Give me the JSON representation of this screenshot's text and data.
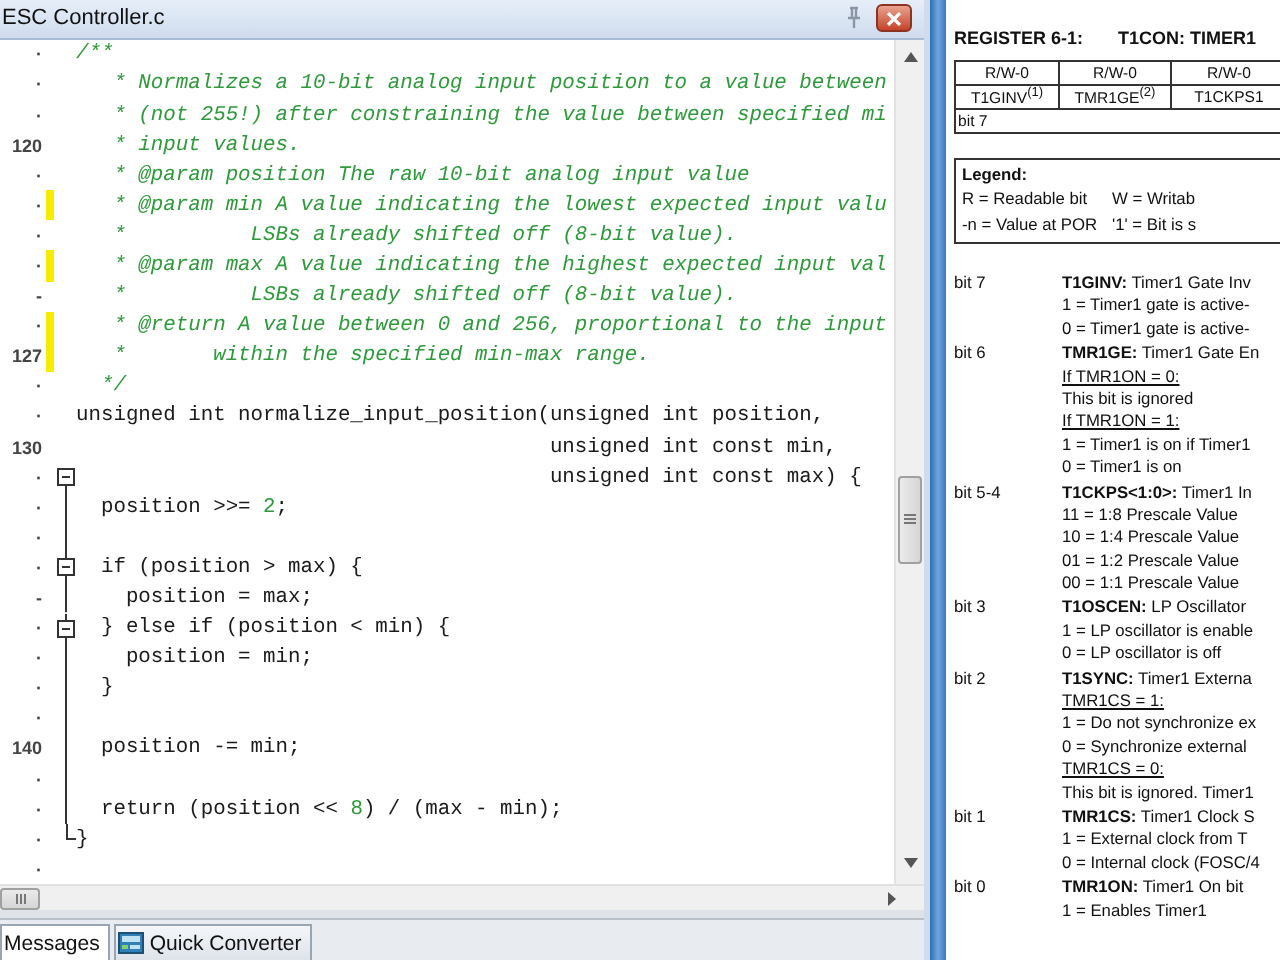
{
  "editor": {
    "title": "ESC Controller.c",
    "lines": [
      {
        "gutter": "·",
        "changed": false,
        "parts": [
          {
            "text": "/**",
            "kind": "comment"
          }
        ]
      },
      {
        "gutter": "·",
        "changed": false,
        "parts": [
          {
            "text": "   * Normalizes a 10-bit analog input position to a value between",
            "kind": "comment"
          }
        ]
      },
      {
        "gutter": "·",
        "changed": false,
        "parts": [
          {
            "text": "   * (not 255!) after constraining the value between specified mi",
            "kind": "comment"
          }
        ]
      },
      {
        "gutter": "120",
        "changed": false,
        "parts": [
          {
            "text": "   * input values.",
            "kind": "comment"
          }
        ]
      },
      {
        "gutter": "·",
        "changed": false,
        "parts": [
          {
            "text": "   * @param position The raw 10-bit analog input value",
            "kind": "comment"
          }
        ]
      },
      {
        "gutter": "·",
        "changed": true,
        "parts": [
          {
            "text": "   * @param min A value indicating the lowest expected input valu",
            "kind": "comment"
          }
        ]
      },
      {
        "gutter": "·",
        "changed": false,
        "parts": [
          {
            "text": "   *          LSBs already shifted off (8-bit value).",
            "kind": "comment"
          }
        ]
      },
      {
        "gutter": "·",
        "changed": true,
        "parts": [
          {
            "text": "   * @param max A value indicating the highest expected input val",
            "kind": "comment"
          }
        ]
      },
      {
        "gutter": "-",
        "changed": false,
        "parts": [
          {
            "text": "   *          LSBs already shifted off (8-bit value).",
            "kind": "comment"
          }
        ]
      },
      {
        "gutter": "·",
        "changed": true,
        "parts": [
          {
            "text": "   * @return A value between 0 and 256, proportional to the input",
            "kind": "comment"
          }
        ]
      },
      {
        "gutter": "127",
        "changed": true,
        "parts": [
          {
            "text": "   *       within the specified min-max range.",
            "kind": "comment"
          }
        ]
      },
      {
        "gutter": "·",
        "changed": false,
        "parts": [
          {
            "text": "  */",
            "kind": "comment"
          }
        ]
      },
      {
        "gutter": "·",
        "changed": false,
        "parts": [
          {
            "text": "unsigned int normalize_input_position(unsigned int position,",
            "kind": "code"
          }
        ]
      },
      {
        "gutter": "130",
        "changed": false,
        "parts": [
          {
            "text": "                                      unsigned int const min,",
            "kind": "code"
          }
        ]
      },
      {
        "gutter": "·",
        "changed": false,
        "kind": "fold_start",
        "parts": [
          {
            "text": "                                      unsigned int const max) {",
            "kind": "code"
          }
        ]
      },
      {
        "gutter": "·",
        "changed": false,
        "kind": "fold_body",
        "parts": [
          {
            "text": "  position >>= ",
            "kind": "code"
          },
          {
            "text": "2",
            "kind": "number"
          },
          {
            "text": ";",
            "kind": "code"
          }
        ]
      },
      {
        "gutter": "·",
        "changed": false,
        "kind": "fold_body"
      },
      {
        "gutter": "·",
        "changed": false,
        "kind": "fold_nested",
        "parts": [
          {
            "text": "  if (position > max) {",
            "kind": "code"
          }
        ]
      },
      {
        "gutter": "-",
        "changed": false,
        "kind": "fold_body",
        "parts": [
          {
            "text": "    position = max;",
            "kind": "code"
          }
        ]
      },
      {
        "gutter": "·",
        "changed": false,
        "kind": "fold_nested",
        "parts": [
          {
            "text": "  } else if (position < min) {",
            "kind": "code"
          }
        ]
      },
      {
        "gutter": "·",
        "changed": false,
        "kind": "fold_body",
        "parts": [
          {
            "text": "    position = min;",
            "kind": "code"
          }
        ]
      },
      {
        "gutter": "·",
        "changed": false,
        "kind": "fold_body",
        "parts": [
          {
            "text": "  }",
            "kind": "code"
          }
        ]
      },
      {
        "gutter": "·",
        "changed": false,
        "kind": "fold_body"
      },
      {
        "gutter": "140",
        "changed": false,
        "kind": "fold_body",
        "parts": [
          {
            "text": "  position -= min;",
            "kind": "code"
          }
        ]
      },
      {
        "gutter": "·",
        "changed": false,
        "kind": "fold_body"
      },
      {
        "gutter": "·",
        "changed": false,
        "kind": "fold_body",
        "parts": [
          {
            "text": "  return (position << ",
            "kind": "code"
          },
          {
            "text": "8",
            "kind": "number"
          },
          {
            "text": ") / (max - min);",
            "kind": "code"
          }
        ]
      },
      {
        "gutter": "·",
        "changed": false,
        "kind": "fold_end",
        "parts": [
          {
            "text": "}",
            "kind": "code"
          }
        ]
      },
      {
        "gutter": "·",
        "changed": false
      }
    ]
  },
  "bottom_tabs": [
    {
      "label": "Messages",
      "selected": true
    },
    {
      "label": "Quick Converter",
      "selected": false
    }
  ],
  "datasheet": {
    "register_label": "REGISTER 6-1:",
    "register_name": "T1CON: TIMER1",
    "table": {
      "access": [
        "R/W-0",
        "R/W-0",
        "R/W-0"
      ],
      "bits": [
        "T1GINV$^{(1)}$",
        "TMR1GE$^{(2)}$",
        "T1CKPS1"
      ],
      "bit_label": "bit 7"
    },
    "legend": {
      "title": "Legend:",
      "entries": [
        "R = Readable bit",
        "W = Writab",
        "-n = Value at POR",
        "'1' = Bit is s"
      ]
    },
    "bits": [
      {
        "label": "bit 7",
        "title": "**T1GINV:** Timer1 Gate Inv",
        "lines": [
          {
            "text": "1 = Timer1 gate is active-",
            "kind": "value"
          },
          {
            "text": "0 = Timer1 gate is active-",
            "kind": "value"
          }
        ]
      },
      {
        "label": "bit 6",
        "title": "**TMR1GE:** Timer1 Gate En",
        "lines": [
          {
            "text": "If TMR1ON = 0:",
            "kind": "condition"
          },
          {
            "text": "This bit is ignored",
            "kind": "value"
          },
          {
            "text": "If TMR1ON = 1:",
            "kind": "condition"
          },
          {
            "text": "1 = Timer1 is on if Timer1",
            "kind": "value"
          },
          {
            "text": "0 = Timer1 is on",
            "kind": "value"
          }
        ]
      },
      {
        "label": "bit 5-4",
        "title": "**T1CKPS<1:0>:** Timer1 In",
        "lines": [
          {
            "text": "11 = 1:8 Prescale Value",
            "kind": "value"
          },
          {
            "text": "10 = 1:4 Prescale Value",
            "kind": "value"
          },
          {
            "text": "01 = 1:2 Prescale Value",
            "kind": "value"
          },
          {
            "text": "00 = 1:1 Prescale Value",
            "kind": "value"
          }
        ]
      },
      {
        "label": "bit 3",
        "title": "**T1OSCEN:** LP Oscillator",
        "lines": [
          {
            "text": "1 = LP oscillator is enable",
            "kind": "value"
          },
          {
            "text": "0 = LP oscillator is off",
            "kind": "value"
          }
        ]
      },
      {
        "label": "bit 2",
        "title": "**T1SYNC:** Timer1 Externa",
        "lines": [
          {
            "text": "TMR1CS = 1:",
            "kind": "condition"
          },
          {
            "text": "1 = Do not synchronize ex",
            "kind": "value"
          },
          {
            "text": "0 = Synchronize external",
            "kind": "value"
          },
          {
            "text": "TMR1CS = 0:",
            "kind": "condition"
          },
          {
            "text": "This bit is ignored. Timer1",
            "kind": "value"
          }
        ]
      },
      {
        "label": "bit 1",
        "title": "**TMR1CS:** Timer1 Clock S",
        "lines": [
          {
            "text": "1 = External clock from T",
            "kind": "value"
          },
          {
            "text": "0 = Internal clock (FOSC/4",
            "kind": "value"
          }
        ]
      },
      {
        "label": "bit 0",
        "title": "**TMR1ON:** Timer1 On bit",
        "lines": [
          {
            "text": "1 = Enables Timer1",
            "kind": "value"
          }
        ]
      }
    ]
  }
}
